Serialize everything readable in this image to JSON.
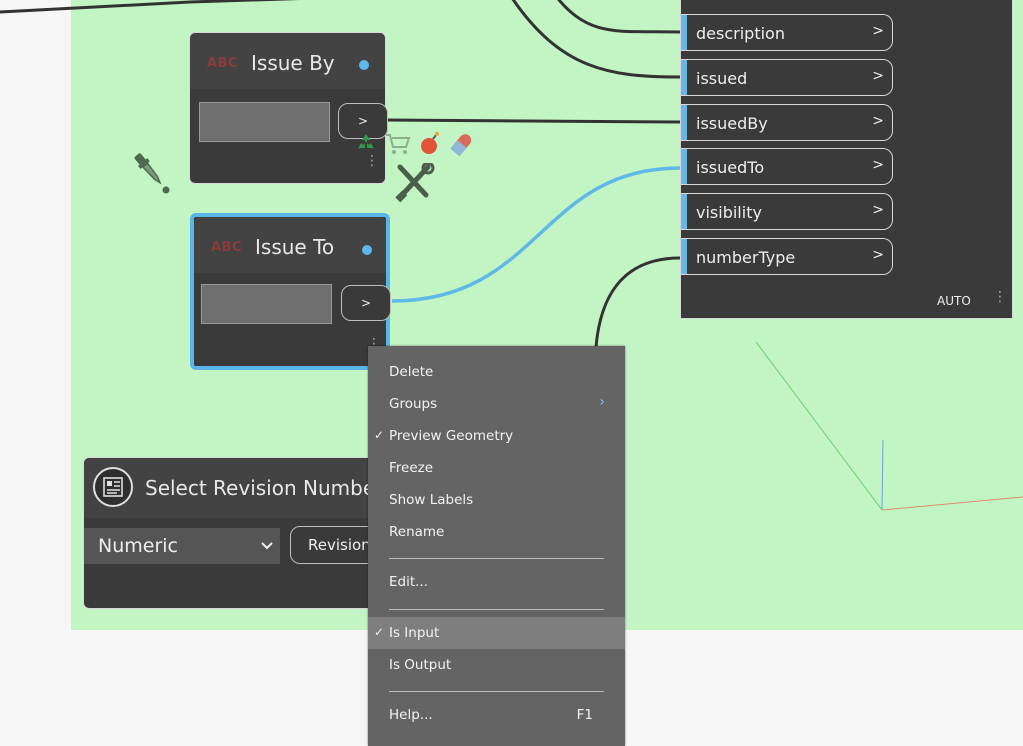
{
  "issue_by_node": {
    "abc": "ABC",
    "title": "Issue By",
    "out_label": ">"
  },
  "issue_to_node": {
    "abc": "ABC",
    "title": "Issue To",
    "out_label": ">"
  },
  "ports": [
    {
      "label": "description",
      "arrow": ">"
    },
    {
      "label": "issued",
      "arrow": ">"
    },
    {
      "label": "issuedBy",
      "arrow": ">"
    },
    {
      "label": "issuedTo",
      "arrow": ">"
    },
    {
      "label": "visibility",
      "arrow": ">"
    },
    {
      "label": "numberType",
      "arrow": ">"
    }
  ],
  "right_node": {
    "lacing": "AUTO"
  },
  "revision_node": {
    "title": "Select Revision Numbe",
    "select_value": "Numeric",
    "out_label": "Revision"
  },
  "context_menu": {
    "items": [
      {
        "label": "Delete"
      },
      {
        "label": "Groups",
        "has_submenu": true
      },
      {
        "label": "Preview Geometry",
        "checked": true
      },
      {
        "label": "Freeze"
      },
      {
        "label": "Show Labels"
      },
      {
        "label": "Rename"
      },
      {
        "label": "Edit..."
      },
      {
        "label": "Is Input",
        "checked": true,
        "highlighted": true
      },
      {
        "label": "Is Output"
      },
      {
        "label": "Help...",
        "shortcut": "F1"
      }
    ],
    "check_glyph": "✓",
    "submenu_glyph": "›"
  },
  "colors": {
    "group_background": "#c3f5c4",
    "selection_border": "#58b6e8",
    "wire_selected": "#5fb8e8",
    "wire_default": "#333333",
    "menu_background": "#646464",
    "menu_highlight": "#7e7e7e"
  },
  "icons": [
    "eyedropper-icon",
    "recycle-icon",
    "cart-icon",
    "bomb-icon",
    "capsule-icon",
    "tools-icon",
    "revision-node-icon",
    "chevron-down-icon",
    "menu-dots-icon"
  ]
}
